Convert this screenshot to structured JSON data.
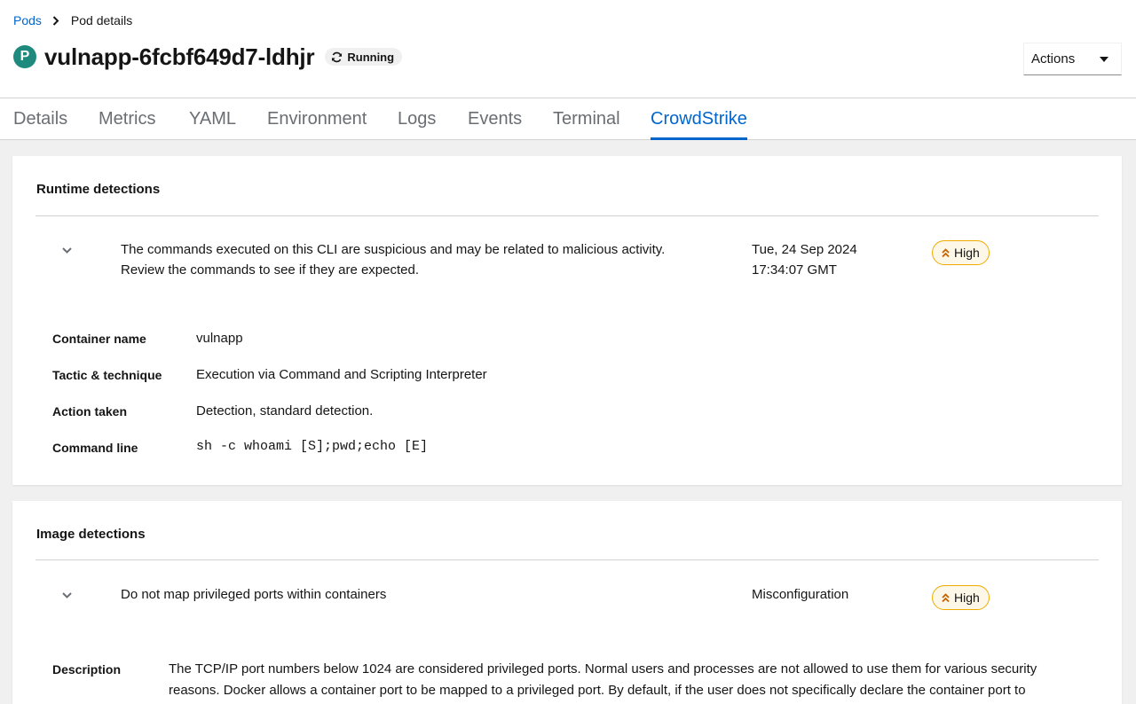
{
  "breadcrumb": {
    "parent": "Pods",
    "current": "Pod details"
  },
  "pod": {
    "badge": "P",
    "name": "vulnapp-6fcbf649d7-ldhjr",
    "status": "Running"
  },
  "actions": {
    "label": "Actions"
  },
  "tabs": [
    {
      "label": "Details"
    },
    {
      "label": "Metrics"
    },
    {
      "label": "YAML"
    },
    {
      "label": "Environment"
    },
    {
      "label": "Logs"
    },
    {
      "label": "Events"
    },
    {
      "label": "Terminal"
    },
    {
      "label": "CrowdStrike",
      "active": true
    }
  ],
  "runtime": {
    "title": "Runtime detections",
    "detection": {
      "line1": "The commands executed on this CLI are suspicious and may be related to malicious activity.",
      "line2": "Review the commands to see if they are expected.",
      "date": "Tue, 24 Sep 2024",
      "time": "17:34:07 GMT",
      "severity": "High"
    },
    "fields": [
      {
        "label": "Container name",
        "value": "vulnapp"
      },
      {
        "label": "Tactic & technique",
        "value": "Execution via Command and Scripting Interpreter"
      },
      {
        "label": "Action taken",
        "value": "Detection, standard detection."
      },
      {
        "label": "Command line",
        "value": "sh -c whoami [S];pwd;echo [E]"
      }
    ]
  },
  "image": {
    "title": "Image detections",
    "detection": {
      "text": "Do not map privileged ports within containers",
      "type": "Misconfiguration",
      "severity": "High"
    },
    "description_label": "Description",
    "description_line1": "The TCP/IP port numbers below 1024 are considered privileged ports. Normal users and processes are not allowed to use them for various security",
    "description_line2": "reasons. Docker allows a container port to be mapped to a privileged port. By default, if the user does not specifically declare the container port to"
  },
  "colors": {
    "link": "#0066cc",
    "pod_badge": "#1e8a7e",
    "severity_border": "#f0ab00"
  }
}
